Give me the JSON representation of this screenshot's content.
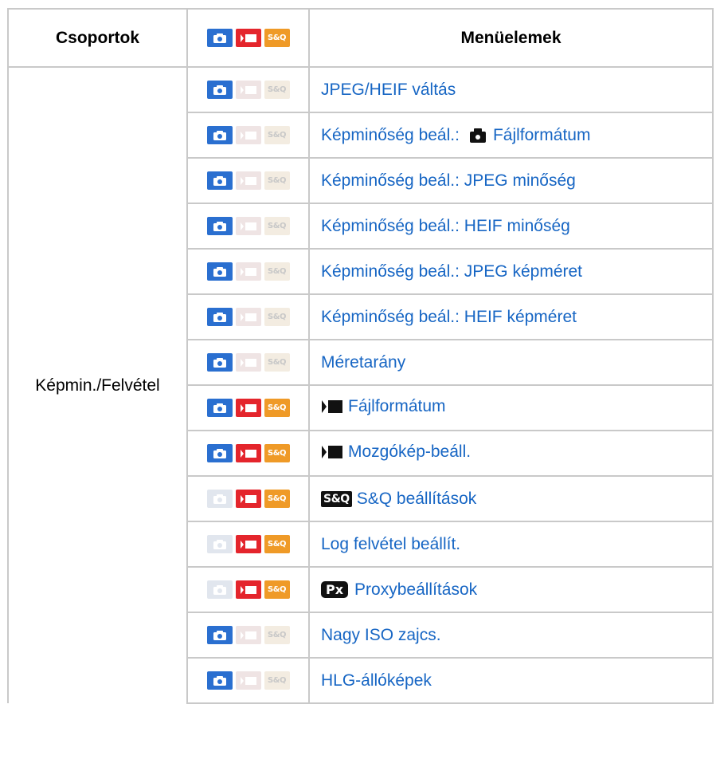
{
  "header": {
    "col_group": "Csoportok",
    "col_items": "Menüelemek"
  },
  "group": {
    "name": "Képmin./Felvétel"
  },
  "icons": {
    "photo": "camera-icon",
    "movie": "movie-icon",
    "sq": "sq-icon",
    "sq_label": "S&Q",
    "px_label": "Px"
  },
  "colors": {
    "photo_active": "#2a6fd0",
    "movie_active": "#e4252c",
    "sq_active": "#ef9a27",
    "link": "#1766c4",
    "border": "#c9c9c9"
  },
  "rows": [
    {
      "label": "JPEG/HEIF váltás",
      "photo": true,
      "movie": false,
      "sq": false,
      "prefix": ""
    },
    {
      "label_pre": "Képminőség beál.:",
      "label": "Fájlformátum",
      "photo": true,
      "movie": false,
      "sq": false,
      "prefix": "photo"
    },
    {
      "label": "Képminőség beál.: JPEG minőség",
      "photo": true,
      "movie": false,
      "sq": false,
      "prefix": ""
    },
    {
      "label": "Képminőség beál.: HEIF minőség",
      "photo": true,
      "movie": false,
      "sq": false,
      "prefix": ""
    },
    {
      "label": "Képminőség beál.: JPEG képméret",
      "photo": true,
      "movie": false,
      "sq": false,
      "prefix": ""
    },
    {
      "label": "Képminőség beál.: HEIF képméret",
      "photo": true,
      "movie": false,
      "sq": false,
      "prefix": ""
    },
    {
      "label": "Méretarány",
      "photo": true,
      "movie": false,
      "sq": false,
      "prefix": ""
    },
    {
      "label": "Fájlformátum",
      "photo": true,
      "movie": true,
      "sq": true,
      "prefix": "movie"
    },
    {
      "label": "Mozgókép-beáll.",
      "photo": true,
      "movie": true,
      "sq": true,
      "prefix": "movie"
    },
    {
      "label": "S&Q beállítások",
      "photo": false,
      "movie": true,
      "sq": true,
      "prefix": "sq"
    },
    {
      "label": "Log felvétel beállít.",
      "photo": false,
      "movie": true,
      "sq": true,
      "prefix": ""
    },
    {
      "label": "Proxybeállítások",
      "photo": false,
      "movie": true,
      "sq": true,
      "prefix": "px"
    },
    {
      "label": "Nagy ISO zajcs.",
      "photo": true,
      "movie": false,
      "sq": false,
      "prefix": ""
    },
    {
      "label": "HLG-állóképek",
      "photo": true,
      "movie": false,
      "sq": false,
      "prefix": ""
    }
  ]
}
